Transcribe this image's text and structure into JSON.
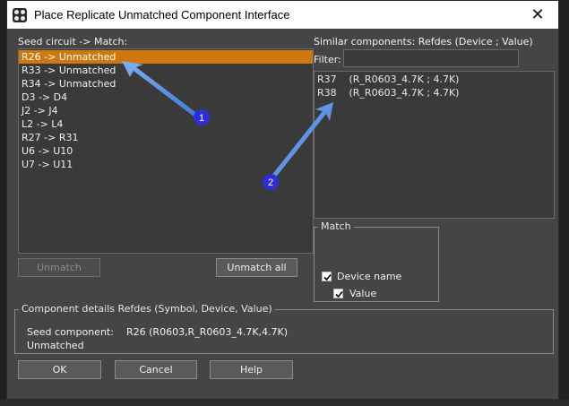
{
  "window": {
    "title": "Place Replicate Unmatched Component Interface",
    "close_glyph": "✕"
  },
  "seed": {
    "label": "Seed circuit -> Match:",
    "items": [
      "R26 -> Unmatched",
      "R33 -> Unmatched",
      "R34 -> Unmatched",
      "D3 -> D4",
      "J2 -> J4",
      "L2 -> L4",
      "R27 -> R31",
      "U6 -> U10",
      "U7 -> U11"
    ],
    "selected_index": 0
  },
  "similar": {
    "label": "Similar components:  Refdes  (Device ; Value)",
    "filter_label": "Filter:",
    "filter_value": "",
    "items": [
      {
        "ref": "R37",
        "desc": "(R_R0603_4.7K ; 4.7K)"
      },
      {
        "ref": "R38",
        "desc": "(R_R0603_4.7K ; 4.7K)"
      }
    ]
  },
  "match": {
    "title": "Match",
    "device_name": {
      "label": "Device name",
      "checked": true
    },
    "value": {
      "label": "Value",
      "checked": true
    }
  },
  "buttons": {
    "unmatch": "Unmatch",
    "unmatch_all": "Unmatch all",
    "ok": "OK",
    "cancel": "Cancel",
    "help": "Help"
  },
  "details": {
    "title": "Component details  Refdes (Symbol, Device, Value)",
    "seed_label": "Seed component:",
    "seed_value": "R26 (R0603,R_R0603_4.7K,4.7K)",
    "status": "Unmatched"
  },
  "annotations": {
    "marker1": "1",
    "marker2": "2",
    "color": "#3f78d8"
  },
  "colors": {
    "selection": "#d07810",
    "dialog_bg": "#454545"
  }
}
